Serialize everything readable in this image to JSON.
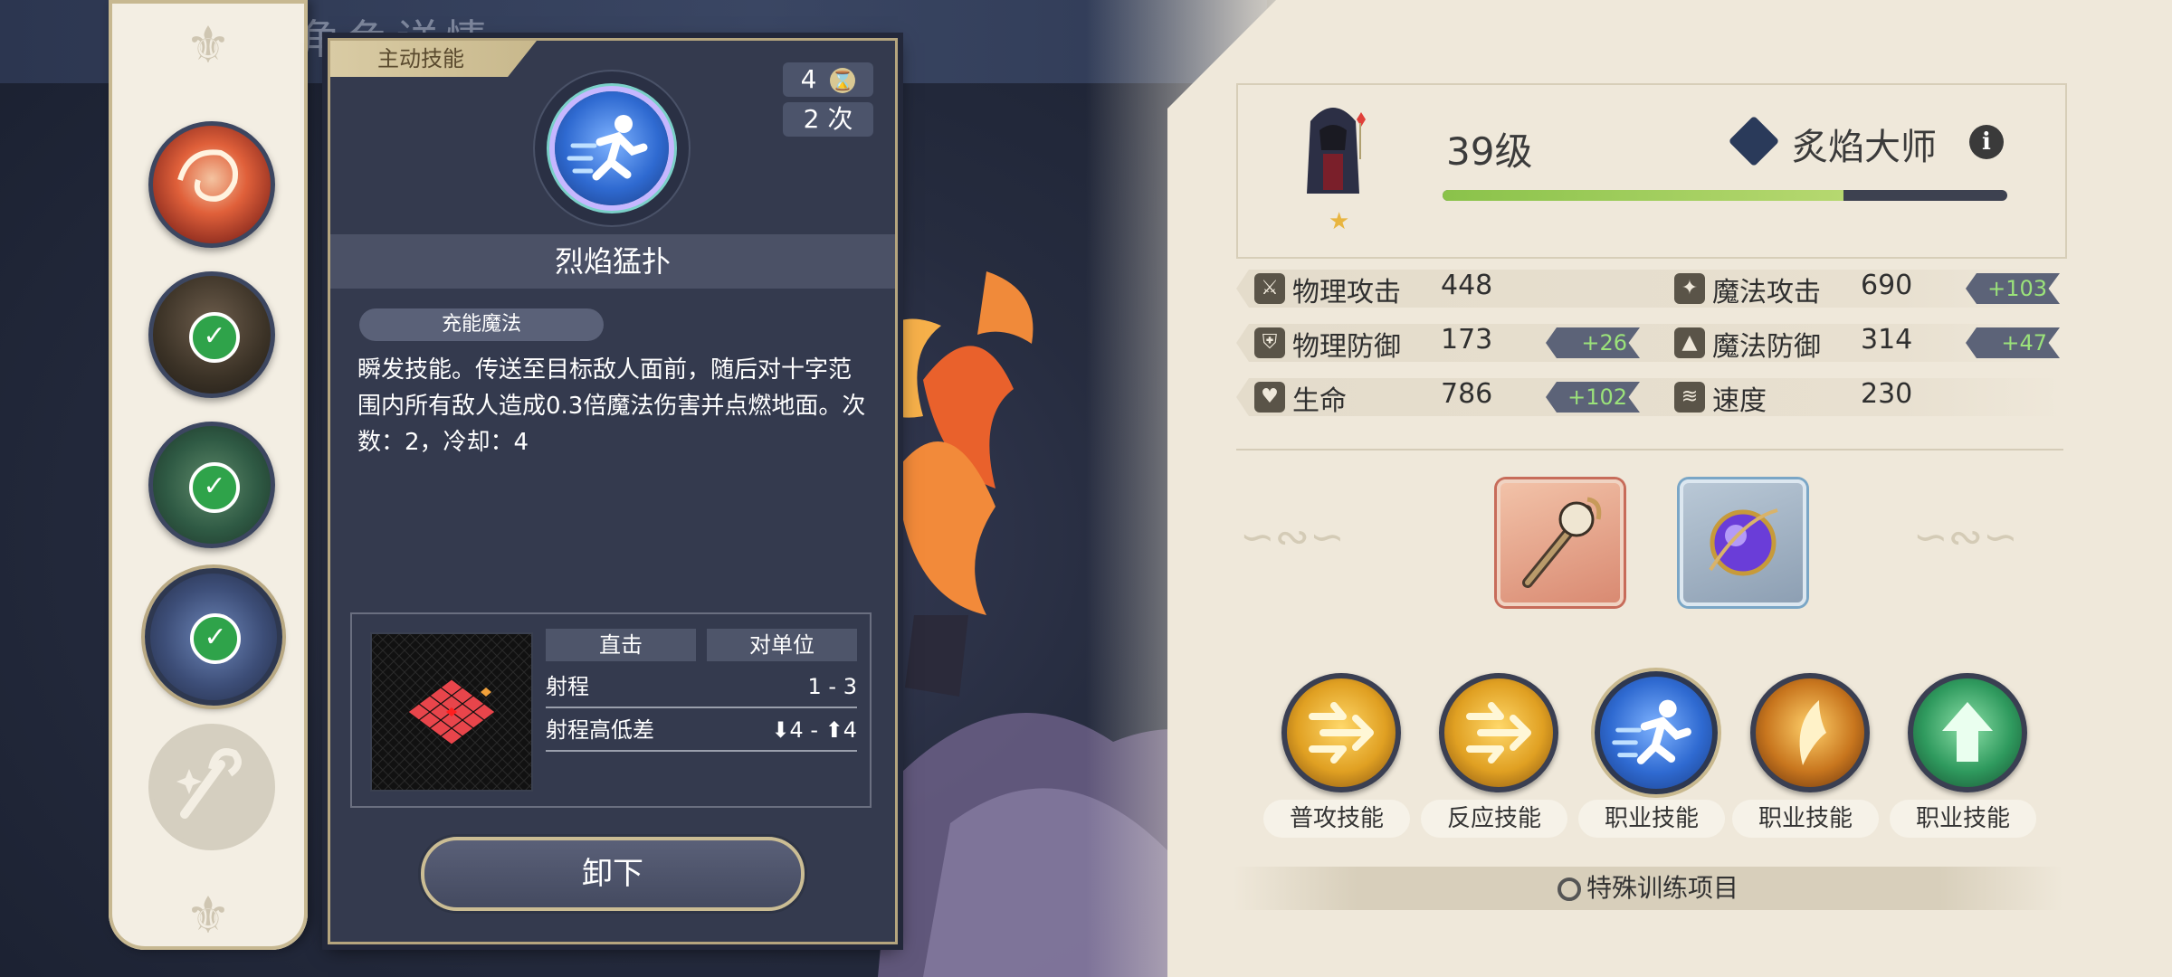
{
  "header": {
    "title": "角色详情"
  },
  "sidebar": {
    "skills": [
      {
        "name": "fire-vortex-skill",
        "equipped": false
      },
      {
        "name": "hooded-aura-skill",
        "equipped": true
      },
      {
        "name": "green-rune-skill",
        "equipped": true
      },
      {
        "name": "dash-skill",
        "equipped": true,
        "selected": true
      },
      {
        "name": "staff-sparkle-skill",
        "equipped": false,
        "locked": true
      }
    ]
  },
  "skill_panel": {
    "tag": "主动技能",
    "cost": "4",
    "uses": "2 次",
    "name": "烈焰猛扑",
    "charge_type": "充能魔法",
    "description": "瞬发技能。传送至目标敌人面前，随后对十字范围内所有敌人造成0.3倍魔法伤害并点燃地面。次数：2，冷却：4",
    "attack_type": "直击",
    "target_type": "对单位",
    "range_label": "射程",
    "range_value": "1 - 3",
    "height_label": "射程高低差",
    "height_value": "⬇4 - ⬆4",
    "unequip_label": "卸下"
  },
  "character": {
    "level": "39级",
    "class_name": "炙焰大师",
    "exp_progress": 0.71,
    "stars": 1
  },
  "stats": [
    {
      "label": "物理攻击",
      "value": "448",
      "bonus": ""
    },
    {
      "label": "魔法攻击",
      "value": "690",
      "bonus": "+103"
    },
    {
      "label": "物理防御",
      "value": "173",
      "bonus": "+26"
    },
    {
      "label": "魔法防御",
      "value": "314",
      "bonus": "+47"
    },
    {
      "label": "生命",
      "value": "786",
      "bonus": "+102"
    },
    {
      "label": "速度",
      "value": "230",
      "bonus": ""
    }
  ],
  "equipment": [
    {
      "name": "skull-staff",
      "rarity_color": "#e89c7a"
    },
    {
      "name": "purple-orb",
      "rarity_color": "#8fb8d8"
    }
  ],
  "battle_skills": [
    {
      "label": "普攻技能",
      "icon": "double-arrow-icon"
    },
    {
      "label": "反应技能",
      "icon": "double-arrow-icon"
    },
    {
      "label": "职业技能",
      "icon": "dash-icon"
    },
    {
      "label": "职业技能",
      "icon": "flame-slash-icon"
    },
    {
      "label": "职业技能",
      "icon": "green-up-arrow-icon"
    }
  ],
  "training": {
    "label": "特殊训练项目"
  },
  "colors": {
    "bonus_text": "#9be27a",
    "exp_fill": "#8ac24a",
    "panel_border": "#b5a57e"
  }
}
